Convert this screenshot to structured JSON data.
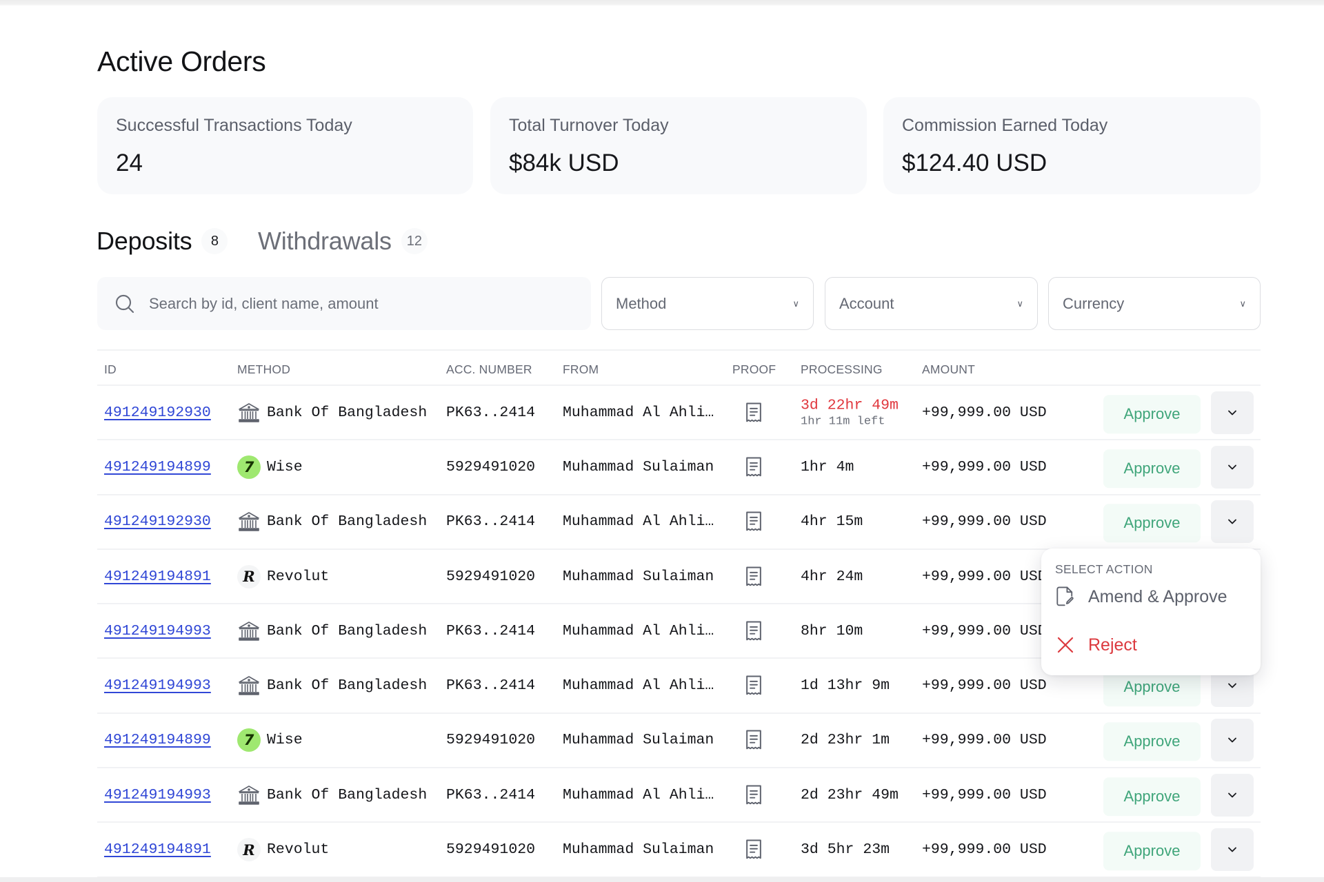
{
  "page": {
    "title": "Active Orders"
  },
  "stats": [
    {
      "label": "Successful Transactions Today",
      "value": "24"
    },
    {
      "label": "Total Turnover Today",
      "value": "$84k USD"
    },
    {
      "label": "Commission Earned Today",
      "value": "$124.40 USD"
    }
  ],
  "tabs": [
    {
      "label": "Deposits",
      "count": "8",
      "active": true
    },
    {
      "label": "Withdrawals",
      "count": "12",
      "active": false
    }
  ],
  "filters": {
    "search_placeholder": "Search by id, client name, amount",
    "search_value": "",
    "method": "Method",
    "account": "Account",
    "currency": "Currency"
  },
  "table": {
    "columns": [
      "ID",
      "METHOD",
      "ACC. NUMBER",
      "FROM",
      "PROOF",
      "PROCESSING",
      "AMOUNT"
    ],
    "approve_label": "Approve",
    "rows": [
      {
        "id": "491249192930",
        "method": "Bank Of Bangladesh",
        "method_icon": "bank-icon",
        "acc": "PK63..2414",
        "from": "Muhammad Al Ahli…",
        "processing": "3d 22hr 49m",
        "processing_sub": "1hr 11m left",
        "overdue": true,
        "amount": "+99,999.00 USD"
      },
      {
        "id": "491249194899",
        "method": "Wise",
        "method_icon": "wise-icon",
        "acc": "5929491020",
        "from": "Muhammad Sulaiman",
        "processing": "1hr 4m",
        "processing_sub": "",
        "overdue": false,
        "amount": "+99,999.00 USD"
      },
      {
        "id": "491249192930",
        "method": "Bank Of Bangladesh",
        "method_icon": "bank-icon",
        "acc": "PK63..2414",
        "from": "Muhammad Al Ahli…",
        "processing": "4hr 15m",
        "processing_sub": "",
        "overdue": false,
        "amount": "+99,999.00 USD"
      },
      {
        "id": "491249194891",
        "method": "Revolut",
        "method_icon": "revolut-icon",
        "acc": "5929491020",
        "from": "Muhammad Sulaiman",
        "processing": "4hr 24m",
        "processing_sub": "",
        "overdue": false,
        "amount": "+99,999.00 USD"
      },
      {
        "id": "491249194993",
        "method": "Bank Of Bangladesh",
        "method_icon": "bank-icon",
        "acc": "PK63..2414",
        "from": "Muhammad Al Ahli…",
        "processing": "8hr 10m",
        "processing_sub": "",
        "overdue": false,
        "amount": "+99,999.00 USD"
      },
      {
        "id": "491249194993",
        "method": "Bank Of Bangladesh",
        "method_icon": "bank-icon",
        "acc": "PK63..2414",
        "from": "Muhammad Al Ahli…",
        "processing": "1d 13hr 9m",
        "processing_sub": "",
        "overdue": false,
        "amount": "+99,999.00 USD"
      },
      {
        "id": "491249194899",
        "method": "Wise",
        "method_icon": "wise-icon",
        "acc": "5929491020",
        "from": "Muhammad Sulaiman",
        "processing": "2d 23hr 1m",
        "processing_sub": "",
        "overdue": false,
        "amount": "+99,999.00 USD"
      },
      {
        "id": "491249194993",
        "method": "Bank Of Bangladesh",
        "method_icon": "bank-icon",
        "acc": "PK63..2414",
        "from": "Muhammad Al Ahli…",
        "processing": "2d 23hr 49m",
        "processing_sub": "",
        "overdue": false,
        "amount": "+99,999.00 USD"
      },
      {
        "id": "491249194891",
        "method": "Revolut",
        "method_icon": "revolut-icon",
        "acc": "5929491020",
        "from": "Muhammad Sulaiman",
        "processing": "3d 5hr 23m",
        "processing_sub": "",
        "overdue": false,
        "amount": "+99,999.00 USD"
      }
    ]
  },
  "action_menu": {
    "open_for_row": 3,
    "title": "SELECT ACTION",
    "items": [
      {
        "label": "Amend & Approve",
        "icon": "file-edit-icon"
      },
      {
        "label": "Reject",
        "icon": "close-icon"
      }
    ]
  },
  "colors": {
    "link": "#3047d6",
    "approve_text": "#3fa57a",
    "approve_bg": "#f3fbf7",
    "overdue": "#e0383e",
    "reject": "#dc3a3f",
    "wise_brand": "#9fe870"
  }
}
